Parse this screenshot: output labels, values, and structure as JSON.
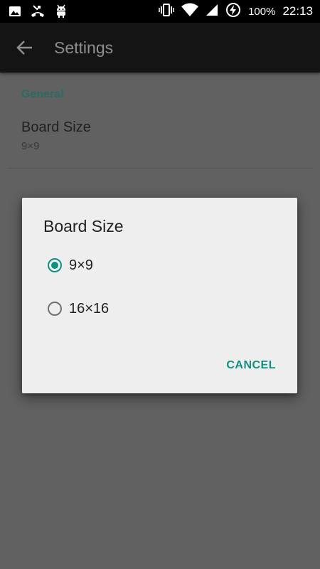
{
  "status_bar": {
    "left_icons": [
      "image-icon",
      "missed-call-icon",
      "android-debug-icon"
    ],
    "right_icons": [
      "vibrate-icon",
      "wifi-icon",
      "signal-icon",
      "battery-charging-icon"
    ],
    "battery": "100%",
    "time": "22:13"
  },
  "app_bar": {
    "back_icon": "arrow-back-icon",
    "title": "Settings"
  },
  "settings": {
    "section_header": "General",
    "preference": {
      "title": "Board Size",
      "summary": "9×9"
    }
  },
  "dialog": {
    "title": "Board Size",
    "options": [
      {
        "label": "9×9",
        "selected": true
      },
      {
        "label": "16×16",
        "selected": false
      }
    ],
    "cancel_label": "CANCEL"
  },
  "colors": {
    "accent": "#0f8f81",
    "scrim_background": "#616161",
    "dialog_background": "#eeeeee",
    "app_bar": "#141414"
  }
}
